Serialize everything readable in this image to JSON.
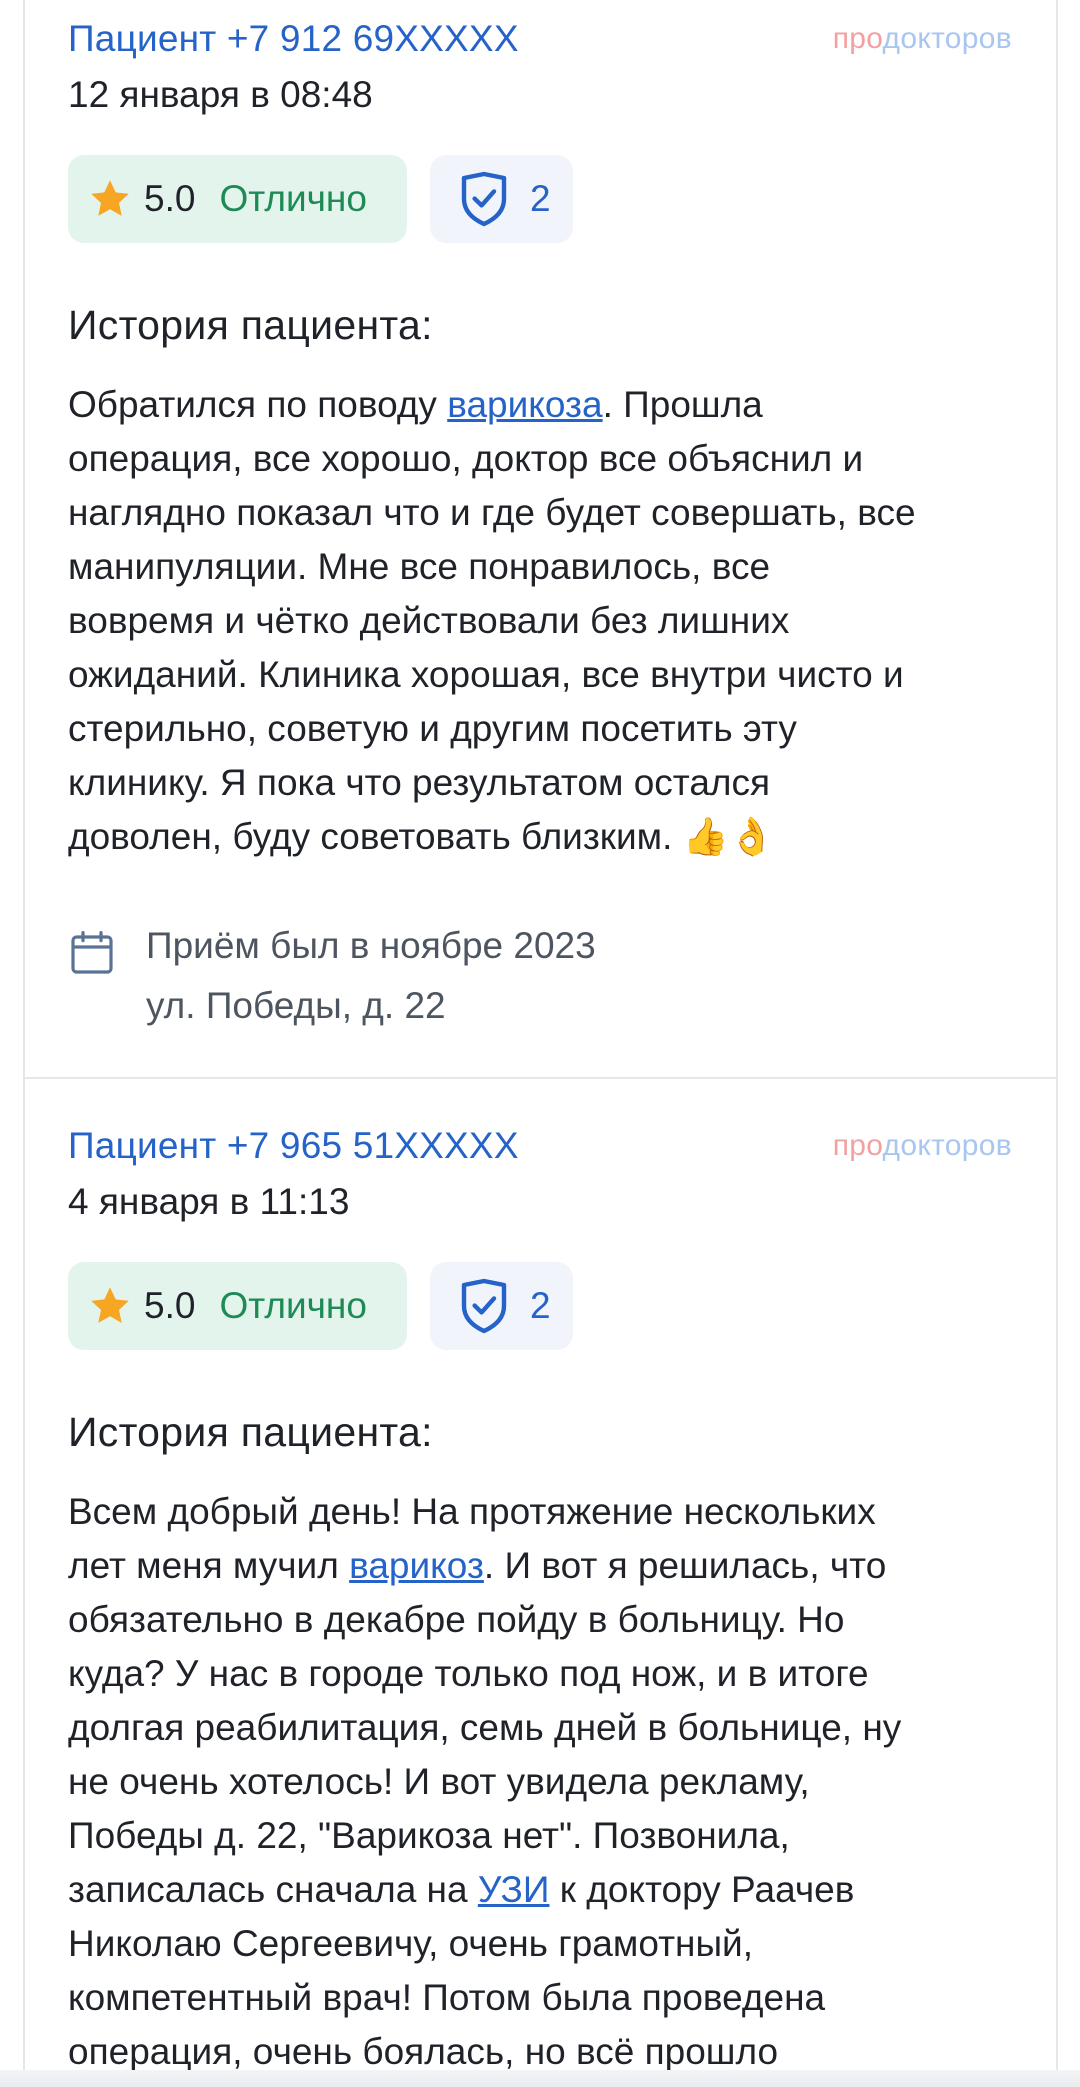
{
  "brand": {
    "pro": "про",
    "rest": "докторов"
  },
  "reviews": [
    {
      "author": "Пациент +7 912 69XXXXX",
      "date": "12 января в 08:48",
      "score": "5.0",
      "score_label": "Отлично",
      "verify_count": "2",
      "heading": "История пациента:",
      "lines": [
        {
          "pre": "Обратился по поводу ",
          "link": "варикоза",
          "post": ". Прошла"
        },
        {
          "pre": "операция, все хорошо, доктор все объяснил и"
        },
        {
          "pre": "наглядно показал что и где будет совершать, все"
        },
        {
          "pre": "манипуляции. Мне все понравилось, все"
        },
        {
          "pre": "вовремя и чётко действовали без лишних"
        },
        {
          "pre": "ожиданий. Клиника хорошая, все внутри чисто и"
        },
        {
          "pre": "стерильно, советую и другим посетить эту"
        },
        {
          "pre": "клинику. Я пока что результатом остался"
        },
        {
          "pre": "доволен, буду советовать близким. 👍👌"
        }
      ],
      "visit_when": "Приём был в ноябре 2023",
      "visit_addr": "ул. Победы, д. 22"
    },
    {
      "author": "Пациент +7 965 51XXXXX",
      "date": "4 января в 11:13",
      "score": "5.0",
      "score_label": "Отлично",
      "verify_count": "2",
      "heading": "История пациента:",
      "lines": [
        {
          "pre": "Всем добрый день! На протяжение нескольких"
        },
        {
          "pre": "лет меня мучил ",
          "link": "варикоз",
          "post": ". И вот я решилась, что"
        },
        {
          "pre": "обязательно в декабре пойду в больницу. Но"
        },
        {
          "pre": "куда? У нас в городе только под нож, и в итоге"
        },
        {
          "pre": "долгая реабилитация, семь дней в больнице, ну"
        },
        {
          "pre": "не очень хотелось! И вот увидела рекламу,"
        },
        {
          "pre": "Победы д. 22, \"Варикоза нет\". Позвонила,"
        },
        {
          "pre": "записалась сначала на ",
          "link": "УЗИ",
          "post": " к доктору Раачев"
        },
        {
          "pre": "Николаю Сергеевичу, очень грамотный,"
        },
        {
          "pre": "компетентный врач! Потом была проведена"
        },
        {
          "pre": "операция, очень боялась, но всё прошло"
        }
      ]
    }
  ],
  "colors": {
    "author": "#2563c9",
    "rating_bg": "#e3f4ec",
    "rating_label": "#1e8a55",
    "star": "#f6a623",
    "verify_bg": "#f1f5fb",
    "link": "#2563c9"
  },
  "icons": {
    "star": "star-icon",
    "shield": "shield-check-icon",
    "calendar": "calendar-icon"
  }
}
